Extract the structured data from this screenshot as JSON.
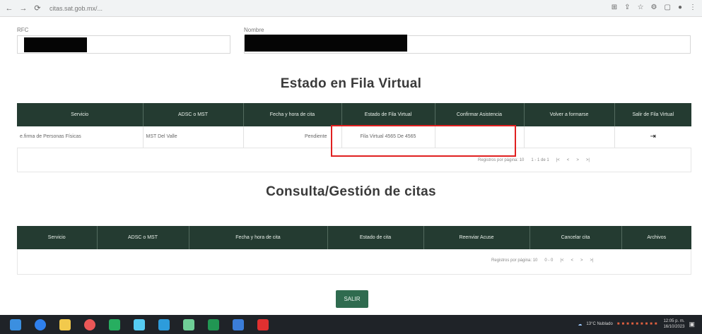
{
  "browser": {
    "url": "citas.sat.gob.mx/...",
    "back": "←",
    "forward": "→",
    "reload": "⟳"
  },
  "form": {
    "rfc_label": "RFC",
    "nombre_label": "Nombre"
  },
  "fila": {
    "title": "Estado en Fila Virtual",
    "headers": [
      "Servicio",
      "ADSC o MST",
      "Fecha y hora de cita",
      "Estado de Fila Virtual",
      "Confirmar Asistencia",
      "Volver a formarse",
      "Salir de Fila Virtual"
    ],
    "row": {
      "servicio": "e.firma de Personas Físicas",
      "adsc": "MST Del Valle",
      "fecha": "Pendiente",
      "estado": "Fila Virtual 4565 De 4565",
      "confirmar": "",
      "volver": "",
      "salir_icon": "exit-icon"
    },
    "pager": {
      "per_page": "Registros por página: 10",
      "range": "1 - 1 de 1",
      "nav": [
        "|<",
        "<",
        ">",
        ">|"
      ]
    }
  },
  "citas": {
    "title": "Consulta/Gestión de citas",
    "headers": [
      "Servicio",
      "ADSC o MST",
      "Fecha y hora de cita",
      "Estado de cita",
      "Reenviar Acuse",
      "Cancelar cita",
      "Archivos"
    ],
    "pager": {
      "per_page": "Registros por página: 10",
      "range": "0 - 0",
      "nav": [
        "|<",
        "<",
        ">",
        ">|"
      ]
    }
  },
  "salir_button": "SALIR",
  "taskbar": {
    "weather": "13°C Nublado",
    "time": "12:05 p. m.",
    "date": "16/10/2023",
    "icon_colors": [
      "#2f80ed",
      "#f2c94c",
      "#eb5757",
      "#27ae60",
      "#56ccf2",
      "#f2994a",
      "#2d9cdb",
      "#6fcf97",
      "#219653",
      "#9b51e0",
      "#eb5757"
    ]
  }
}
